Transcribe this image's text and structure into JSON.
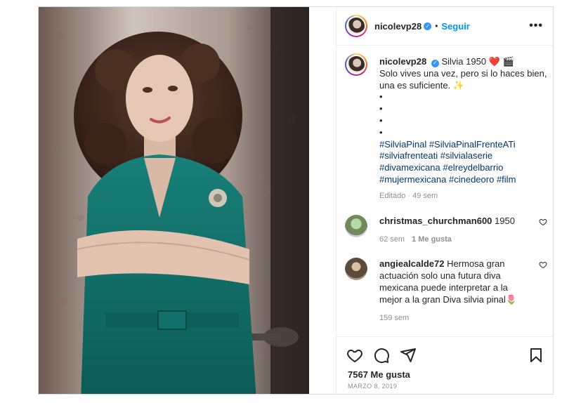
{
  "post": {
    "username": "nicolevp28",
    "follow_label": "Seguir",
    "separator": "•",
    "more_label": "•••"
  },
  "caption": {
    "username": "nicolevp28",
    "line1": "Silvia 1950 ❤️ 🎬",
    "line2": "Solo vives una vez, pero si lo haces bien, una es suficiente. ✨",
    "bullets": [
      "•",
      "•",
      "•",
      "•"
    ],
    "hashtags": [
      "#SilviaPinal",
      "#SilviaPinalFrenteATi",
      "#silviafrenteati",
      "#silvialaserie",
      "#divamexicana",
      "#elreydelbarrio",
      "#mujermexicana",
      "#cinedeoro",
      "#film"
    ],
    "meta": "Editado · 49 sem"
  },
  "comments": [
    {
      "username": "christmas_churchman600",
      "text": "1950",
      "time": "62 sem",
      "likes": "1 Me gusta"
    },
    {
      "username": "angiealcalde72",
      "text": "Hermosa gran actuación solo una futura diva mexicana puede interpretar a la mejor a la gran Diva silvia pinal🌷",
      "time": "159 sem",
      "likes": ""
    }
  ],
  "footer": {
    "likes": "7567 Me gusta",
    "date": "MARZO 8, 2019"
  },
  "colors": {
    "link": "#0095f6",
    "hashtag": "#00376b",
    "muted": "#8e8e8e",
    "dress": "#0f6e68"
  }
}
